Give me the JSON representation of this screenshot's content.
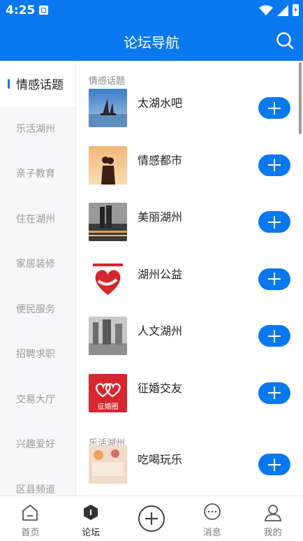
{
  "status_bar": {
    "time": "4:25"
  },
  "header": {
    "title": "论坛导航"
  },
  "sidebar": {
    "items": [
      {
        "label": "情感话题",
        "active": true
      },
      {
        "label": "乐活湖州"
      },
      {
        "label": "亲子教育"
      },
      {
        "label": "住在湖州"
      },
      {
        "label": "家居装修"
      },
      {
        "label": "便民服务"
      },
      {
        "label": "招聘求职"
      },
      {
        "label": "交易大厅"
      },
      {
        "label": "兴趣爱好"
      },
      {
        "label": "区县频道"
      }
    ]
  },
  "content": {
    "section1_title": "情感话题",
    "forums": [
      {
        "name": "太湖水吧"
      },
      {
        "name": "情感都市"
      },
      {
        "name": "美丽湖州"
      },
      {
        "name": "湖州公益"
      },
      {
        "name": "人文湖州"
      },
      {
        "name": "征婚交友",
        "thumb_text": "征婚圈"
      }
    ],
    "section2_title": "乐活湖州",
    "forums2": [
      {
        "name": "吃喝玩乐"
      }
    ]
  },
  "bottom_nav": {
    "home": "首页",
    "forum": "论坛",
    "messages": "消息",
    "mine": "我的"
  },
  "colors": {
    "accent": "#0a78ef"
  }
}
